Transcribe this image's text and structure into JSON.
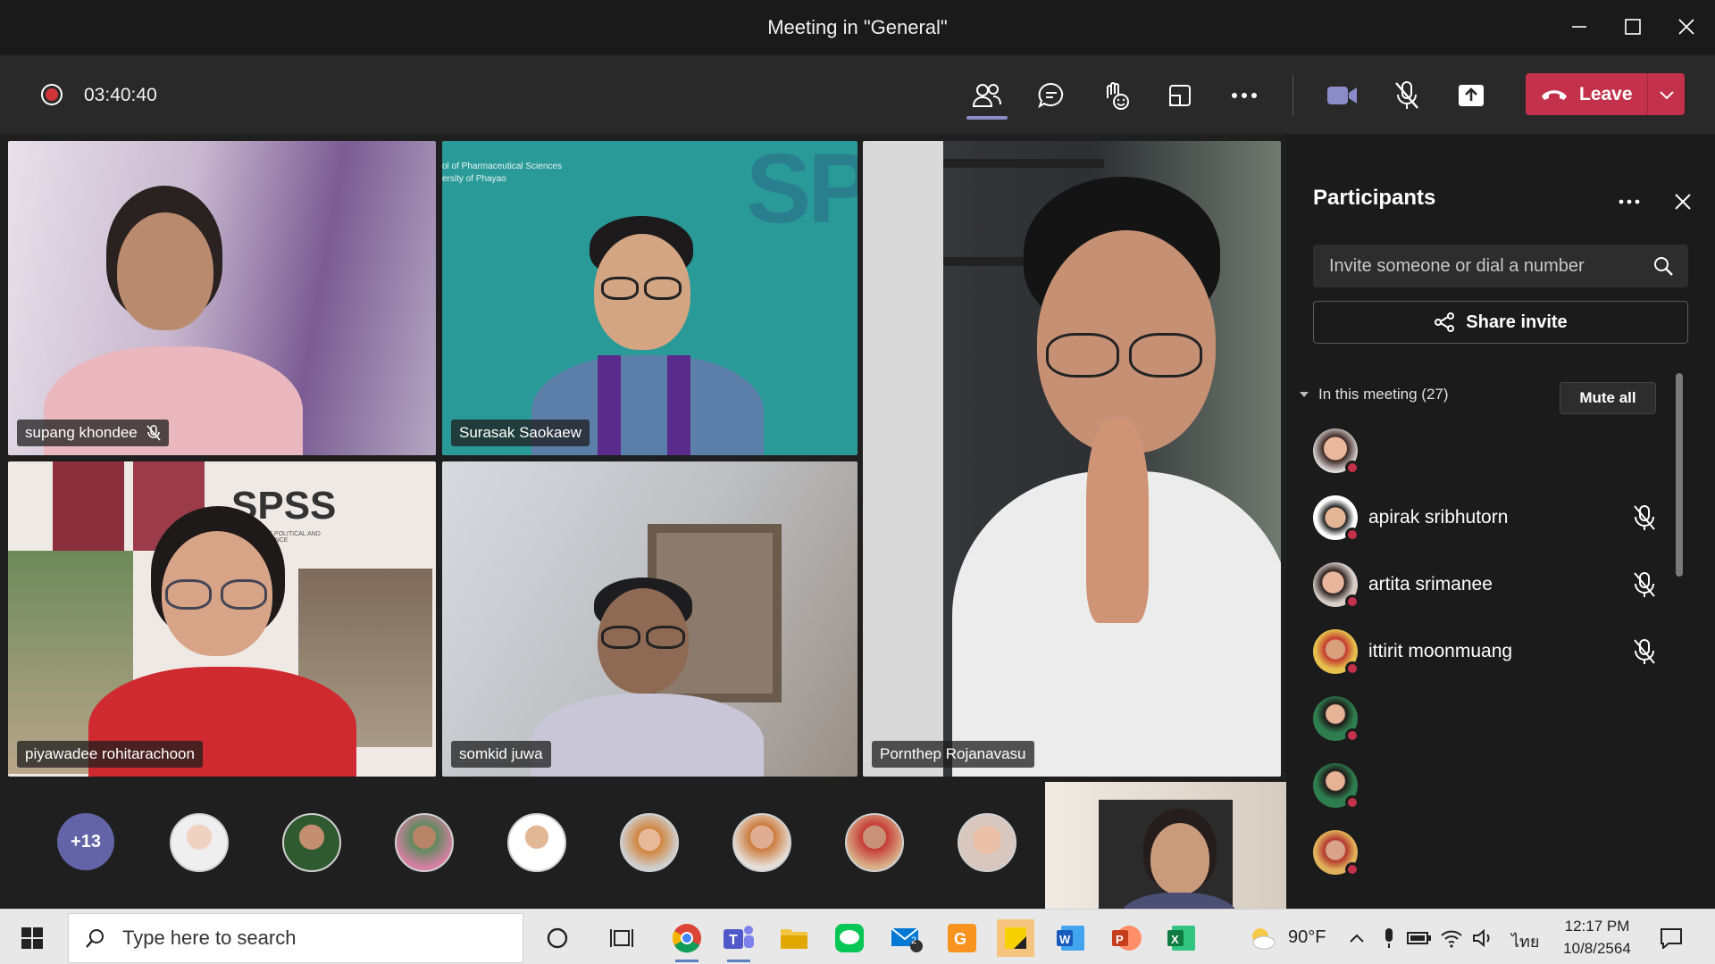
{
  "window": {
    "title": "Meeting in \"General\""
  },
  "toolbar": {
    "timer": "03:40:40",
    "leave_label": "Leave"
  },
  "tiles": [
    {
      "name": "supang khondee"
    },
    {
      "name": "Surasak Saokaew"
    },
    {
      "name": "Pornthep Rojanavasu"
    },
    {
      "name": "piyawadee rohitarachoon"
    },
    {
      "name": "somkid juwa"
    }
  ],
  "tile_text": {
    "sps_line1": "ol of Pharmaceutical Sciences",
    "sps_line2": "ersity of Phayao",
    "spss": "SPSS",
    "spss_small": "SCHOOL OF POLITICAL AND SOCIAL SCIENCE"
  },
  "strip": {
    "overflow_count": "+13"
  },
  "panel": {
    "title": "Participants",
    "invite_placeholder": "Invite someone or dial a number",
    "share_label": "Share invite",
    "section_label": "In this meeting (27)",
    "mute_all_label": "Mute all",
    "participants": [
      {
        "name": ""
      },
      {
        "name": "apirak sribhutorn"
      },
      {
        "name": "artita srimanee"
      },
      {
        "name": "ittirit moonmuang"
      },
      {
        "name": ""
      },
      {
        "name": ""
      },
      {
        "name": ""
      }
    ]
  },
  "taskbar": {
    "search_placeholder": "Type here to search",
    "weather": "90°F",
    "language": "ไทย",
    "time": "12:17 PM",
    "date": "10/8/2564",
    "mail_badge": "2"
  },
  "colors": {
    "accent": "#6264a7",
    "leave": "#c4314b",
    "record": "#d13438"
  }
}
